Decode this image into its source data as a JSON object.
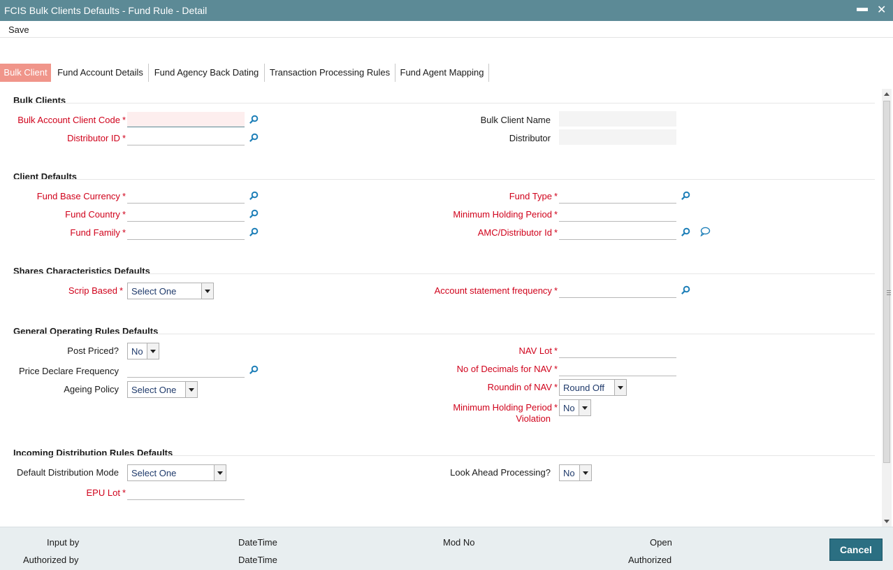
{
  "window": {
    "title": "FCIS Bulk Clients Defaults - Fund Rule - Detail",
    "minimize": "▬",
    "close": "✕"
  },
  "menu": {
    "save": "Save"
  },
  "tabs": [
    "Bulk Client",
    "Fund Account Details",
    "Fund Agency Back Dating",
    "Transaction Processing Rules",
    "Fund Agent Mapping"
  ],
  "sections": {
    "bulk_clients": {
      "title": "Bulk Clients",
      "bulk_account_client_code": "Bulk Account Client Code",
      "distributor_id": "Distributor ID",
      "bulk_client_name": "Bulk Client Name",
      "distributor": "Distributor"
    },
    "client_defaults": {
      "title": "Client Defaults",
      "fund_base_currency": "Fund Base Currency",
      "fund_country": "Fund Country",
      "fund_family": "Fund Family",
      "fund_type": "Fund Type",
      "minimum_holding_period": "Minimum Holding Period",
      "amc_distributor_id": "AMC/Distributor Id"
    },
    "shares": {
      "title": "Shares Characteristics Defaults",
      "scrip_based": "Scrip Based",
      "scrip_based_value": "Select One",
      "account_statement_frequency": "Account statement frequency"
    },
    "general": {
      "title": "General Operating Rules Defaults",
      "post_priced": "Post Priced?",
      "post_priced_value": "No",
      "price_declare_frequency": "Price Declare Frequency",
      "ageing_policy": "Ageing Policy",
      "ageing_policy_value": "Select One",
      "nav_lot": "NAV Lot",
      "no_of_decimals_for_nav": "No of Decimals for NAV",
      "roundin_of_nav": "Roundin of NAV",
      "roundin_of_nav_value": "Round Off",
      "min_holding_violation_1": "Minimum Holding Period",
      "min_holding_violation_2": "Violation",
      "min_holding_violation_value": "No"
    },
    "incoming": {
      "title": "Incoming Distribution Rules Defaults",
      "default_distribution_mode": "Default Distribution Mode",
      "default_distribution_mode_value": "Select One",
      "epu_lot": "EPU Lot",
      "look_ahead_processing": "Look Ahead Processing?",
      "look_ahead_processing_value": "No"
    }
  },
  "footer": {
    "input_by": "Input by",
    "authorized_by": "Authorized by",
    "datetime1": "DateTime",
    "datetime2": "DateTime",
    "mod_no": "Mod No",
    "open": "Open",
    "authorized": "Authorized",
    "cancel": "Cancel"
  },
  "star": "*",
  "colors": {
    "titlebar": "#5c8a96",
    "active_tab": "#f0958a",
    "required": "#d0021b",
    "cancel_button": "#2b6f82"
  },
  "icons": {
    "lookup": "search-icon",
    "comment": "comment-icon"
  }
}
